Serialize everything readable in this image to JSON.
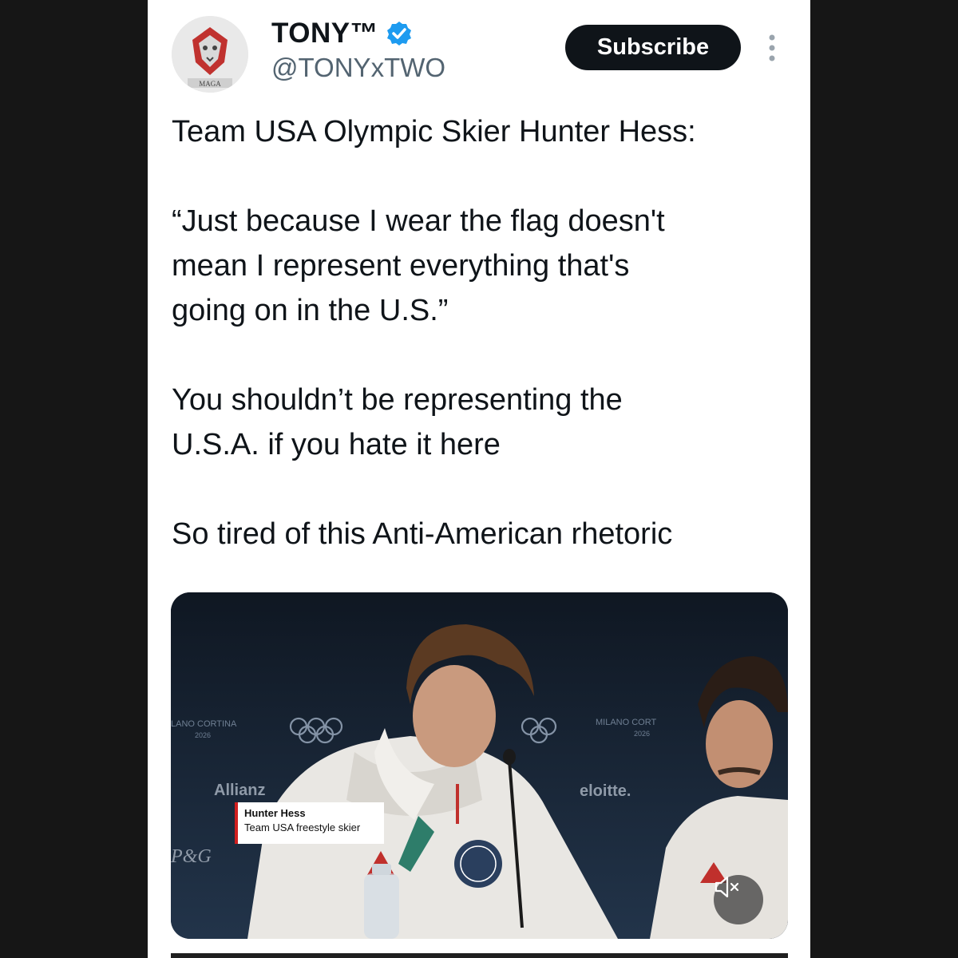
{
  "author": {
    "display_name": "TONY™",
    "handle": "@TONYxTWO",
    "verified": true,
    "avatar_text": "MAGA",
    "avatar_icon": "lion-icon"
  },
  "subscribe_label": "Subscribe",
  "tweet_text": "Team USA Olympic Skier Hunter Hess:\n\n“Just because I wear the flag doesn't\nmean I represent everything that's\ngoing on in the U.S.”\n\nYou shouldn’t be representing the\nU.S.A. if you hate it here\n\nSo tired of this Anti-American rhetoric",
  "media": {
    "caption_name": "Hunter Hess",
    "caption_role": "Team USA freestyle skier",
    "backdrop_text_left": "LANO CORTINA",
    "backdrop_year_left": "2026",
    "backdrop_text_right": "MILANO CORT",
    "backdrop_year_right": "2026",
    "sponsor_left": "Allianz",
    "sponsor_right": "eloitte.",
    "sponsor_pg": "P&G",
    "mute_icon": "speaker-muted-icon"
  },
  "colors": {
    "background": "#161616",
    "card": "#ffffff",
    "verified": "#1d9bf0",
    "button": "#0f1419",
    "caption_accent": "#d11f1f"
  }
}
